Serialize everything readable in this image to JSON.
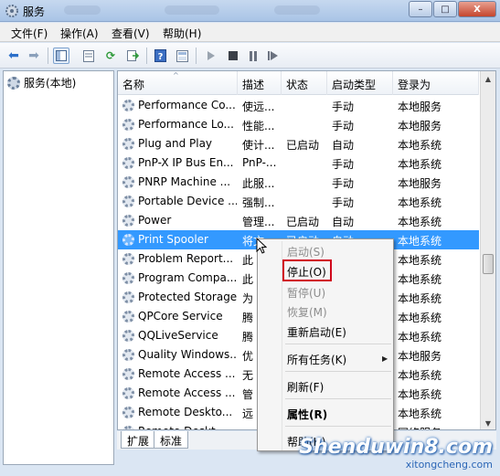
{
  "window": {
    "title": "服务",
    "minimize": "–",
    "maximize": "□",
    "close": "X"
  },
  "menubar": {
    "items": [
      "文件(F)",
      "操作(A)",
      "查看(V)",
      "帮助(H)"
    ]
  },
  "toolbar": {
    "icons": [
      "back-arrow-icon",
      "forward-arrow-icon",
      "console-tree-icon",
      "properties-sheet-icon",
      "refresh-icon",
      "export-icon",
      "help-icon",
      "view-icon",
      "start-icon",
      "stop-icon",
      "pause-icon",
      "restart-icon"
    ]
  },
  "tree": {
    "root": "服务(本地)"
  },
  "table": {
    "columns": [
      "名称",
      "描述",
      "状态",
      "启动类型",
      "登录为"
    ],
    "rows": [
      {
        "name": "Performance Co...",
        "desc": "使远...",
        "status": "",
        "startup": "手动",
        "logon": "本地服务"
      },
      {
        "name": "Performance Lo...",
        "desc": "性能...",
        "status": "",
        "startup": "手动",
        "logon": "本地服务"
      },
      {
        "name": "Plug and Play",
        "desc": "使计...",
        "status": "已启动",
        "startup": "自动",
        "logon": "本地系统"
      },
      {
        "name": "PnP-X IP Bus En...",
        "desc": "PnP-...",
        "status": "",
        "startup": "手动",
        "logon": "本地系统"
      },
      {
        "name": "PNRP Machine ...",
        "desc": "此服...",
        "status": "",
        "startup": "手动",
        "logon": "本地服务"
      },
      {
        "name": "Portable Device ...",
        "desc": "强制...",
        "status": "",
        "startup": "手动",
        "logon": "本地系统"
      },
      {
        "name": "Power",
        "desc": "管理...",
        "status": "已启动",
        "startup": "自动",
        "logon": "本地系统"
      },
      {
        "name": "Print Spooler",
        "desc": "将文",
        "status": "已启动",
        "startup": "自动",
        "logon": "本地系统"
      },
      {
        "name": "Problem Report...",
        "desc": "此",
        "status": "",
        "startup": "",
        "logon": "本地系统"
      },
      {
        "name": "Program Compa...",
        "desc": "此",
        "status": "",
        "startup": "",
        "logon": "本地系统"
      },
      {
        "name": "Protected Storage",
        "desc": "为",
        "status": "",
        "startup": "",
        "logon": "本地系统"
      },
      {
        "name": "QPCore Service",
        "desc": "腾",
        "status": "",
        "startup": "",
        "logon": "本地系统"
      },
      {
        "name": "QQLiveService",
        "desc": "腾",
        "status": "",
        "startup": "",
        "logon": "本地系统"
      },
      {
        "name": "Quality Windows...",
        "desc": "优",
        "status": "",
        "startup": "",
        "logon": "本地服务"
      },
      {
        "name": "Remote Access ...",
        "desc": "无",
        "status": "",
        "startup": "",
        "logon": "本地系统"
      },
      {
        "name": "Remote Access ...",
        "desc": "管",
        "status": "",
        "startup": "",
        "logon": "本地系统"
      },
      {
        "name": "Remote Deskto...",
        "desc": "远",
        "status": "",
        "startup": "",
        "logon": "本地系统"
      },
      {
        "name": "Remote Deskt...",
        "desc": "",
        "status": "",
        "startup": "",
        "logon": "网络服务"
      }
    ],
    "selected_index": 7
  },
  "tabs": [
    "扩展",
    "标准"
  ],
  "context_menu": {
    "start": "启动(S)",
    "stop": "停止(O)",
    "pause": "暂停(U)",
    "resume": "恢复(M)",
    "restart": "重新启动(E)",
    "all_tasks": "所有任务(K)",
    "refresh": "刷新(F)",
    "properties": "属性(R)",
    "help": "帮助(H)"
  },
  "watermark": {
    "main": "Shenduwin8.com",
    "sub": "xitongcheng.com"
  }
}
